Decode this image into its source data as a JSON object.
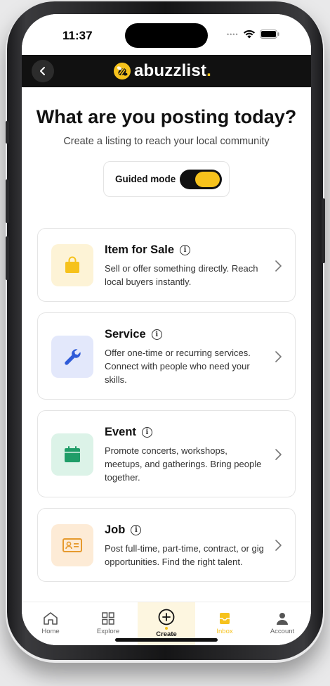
{
  "status_bar": {
    "time": "11:37"
  },
  "header": {
    "logo_text": "abuzzlist",
    "logo_dot": "."
  },
  "page": {
    "title": "What are you posting today?",
    "subtitle": "Create a listing to reach your local community"
  },
  "guided_mode": {
    "label": "Guided mode",
    "enabled": true
  },
  "cards": [
    {
      "title": "Item for Sale",
      "description": "Sell or offer something directly. Reach local buyers instantly.",
      "icon": "shopping-bag-icon",
      "color": "#f6c21c",
      "bg": "#fdf3d6"
    },
    {
      "title": "Service",
      "description": "Offer one-time or recurring services. Connect with people who need your skills.",
      "icon": "wrench-icon",
      "color": "#2f5bd8",
      "bg": "#e3e8fb"
    },
    {
      "title": "Event",
      "description": "Promote concerts, workshops, meetups, and gatherings. Bring people together.",
      "icon": "calendar-icon",
      "color": "#1f9d68",
      "bg": "#dcf3e8"
    },
    {
      "title": "Job",
      "description": "Post full-time, part-time, contract, or gig opportunities. Find the right talent.",
      "icon": "id-card-icon",
      "color": "#e69a2e",
      "bg": "#fdebd6"
    }
  ],
  "tabbar": {
    "home": "Home",
    "explore": "Explore",
    "create": "Create",
    "inbox": "Inbox",
    "account": "Account"
  },
  "colors": {
    "accent": "#f6c21c",
    "header_bg": "#111111"
  }
}
